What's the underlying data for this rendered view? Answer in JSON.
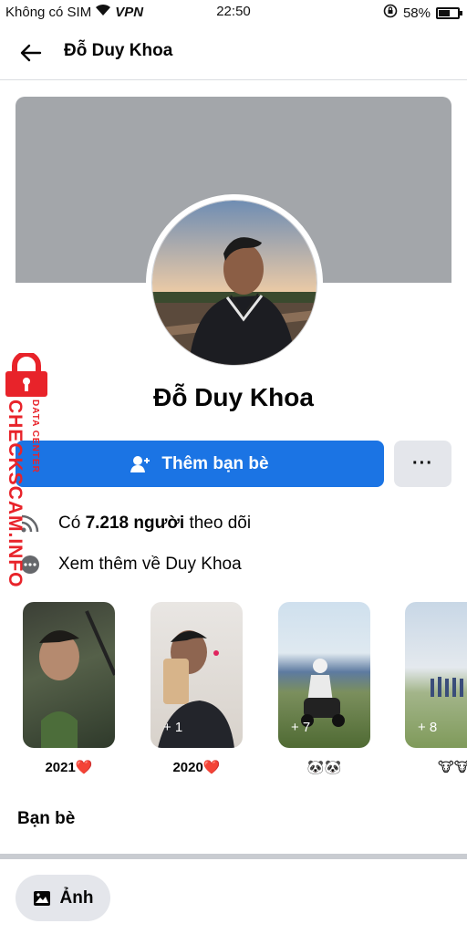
{
  "status_bar": {
    "carrier": "Không có SIM",
    "vpn": "VPN",
    "time": "22:50",
    "battery": "58%",
    "battery_level": 0.58
  },
  "header": {
    "title": "Đỗ Duy Khoa"
  },
  "profile": {
    "name": "Đỗ Duy Khoa"
  },
  "actions": {
    "add_friend": "Thêm bạn bè",
    "more": "···"
  },
  "info": {
    "followers_prefix": "Có ",
    "followers_count": "7.218 người",
    "followers_suffix": " theo dõi",
    "see_more": "Xem thêm về Duy Khoa"
  },
  "highlights": [
    {
      "label": "2021❤️",
      "count": ""
    },
    {
      "label": "2020❤️",
      "count": "+ 1"
    },
    {
      "label": "🐼🐼",
      "count": "+ 7"
    },
    {
      "label": "🐮🐮",
      "count": "+ 8"
    }
  ],
  "sections": {
    "friends_title": "Bạn bè",
    "photos_chip": "Ảnh"
  },
  "watermark": {
    "main": "CHECKSCAM.INFO",
    "sub": "DATA CENTER"
  },
  "colors": {
    "primary": "#1b74e4",
    "cover": "#a3a6aa",
    "chip_bg": "#e4e6eb",
    "watermark": "#e8232a"
  }
}
